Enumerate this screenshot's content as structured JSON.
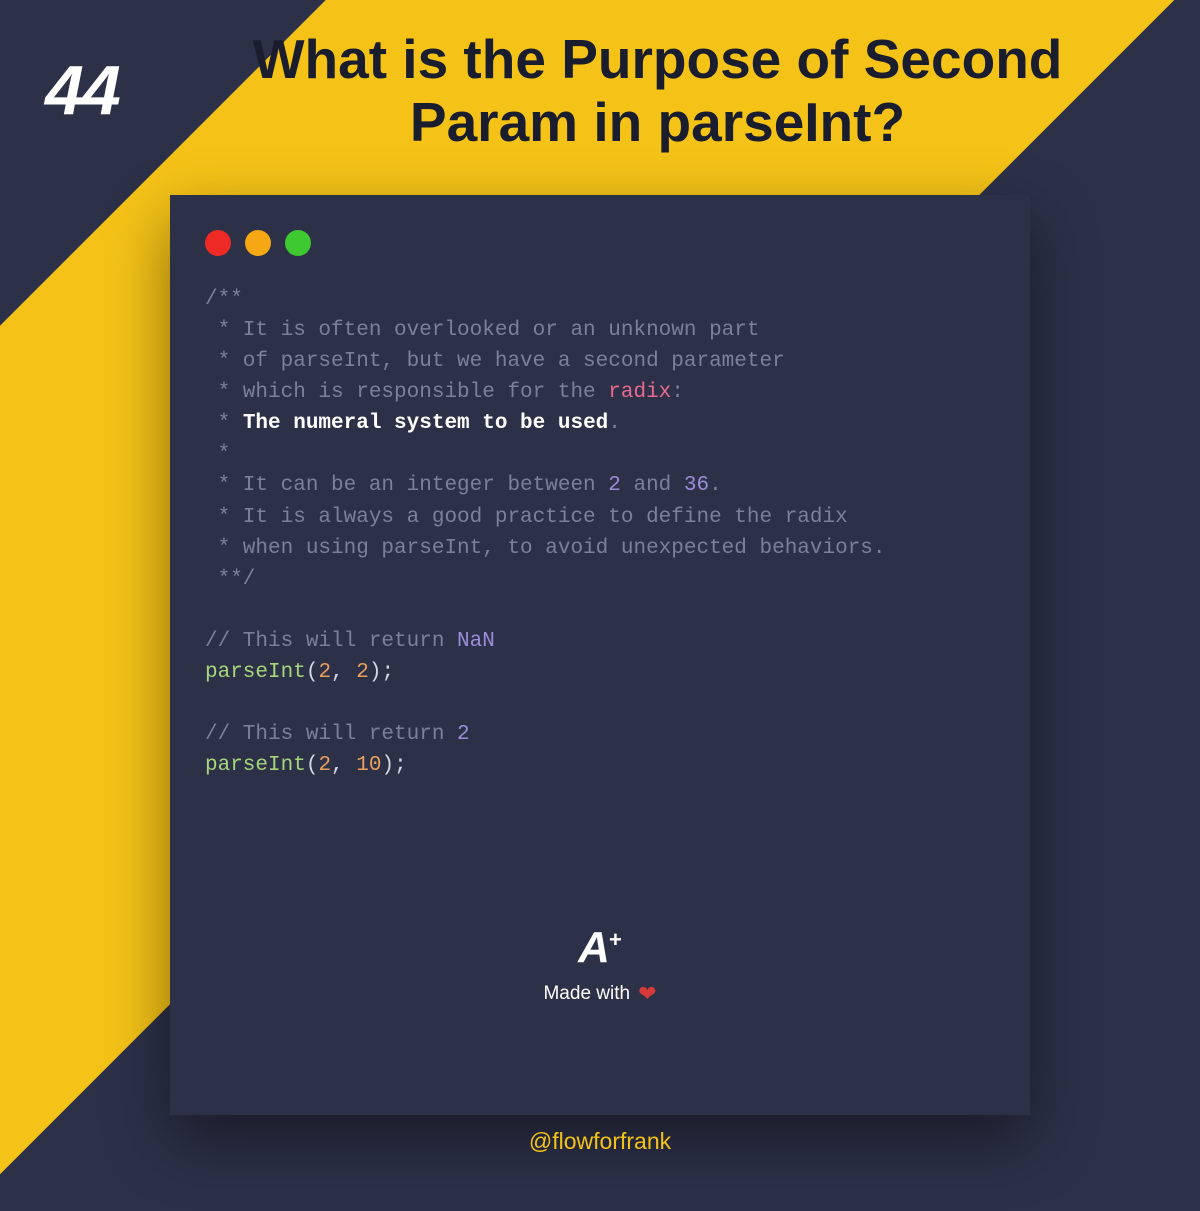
{
  "corner_number": "44",
  "title": "What is the Purpose of Second Param in parseInt?",
  "traffic_dots": [
    "red",
    "yellow",
    "green"
  ],
  "code": {
    "l1": "/**",
    "l2a": " * It is often overlooked or an unknown part",
    "l3a": " * of parseInt, but we have a second parameter",
    "l4a": " * which is responsible for the ",
    "l4b": "radix",
    "l4c": ":",
    "l5a": " * ",
    "l5b": "The numeral system to be used",
    "l5c": ".",
    "l6": " *",
    "l7a": " * It can be an integer between ",
    "l7b": "2",
    "l7c": " and ",
    "l7d": "36",
    "l7e": ".",
    "l8": " * It is always a good practice to define the radix",
    "l9": " * when using parseInt, to avoid unexpected behaviors.",
    "l10": " **/",
    "c1a": "// This will return ",
    "c1b": "NaN",
    "e1a": "parseInt",
    "e1p1": "(",
    "e1n1": "2",
    "e1comma": ", ",
    "e1n2": "2",
    "e1p2": ");",
    "c2a": "// This will return ",
    "c2b": "2",
    "e2a": "parseInt",
    "e2p1": "(",
    "e2n1": "2",
    "e2comma": ", ",
    "e2n2": "10",
    "e2p2": ");"
  },
  "footer": {
    "logo_letter": "A",
    "logo_plus": "+",
    "made_with": "Made with",
    "heart": "❤",
    "handle": "@flowforfrank"
  }
}
